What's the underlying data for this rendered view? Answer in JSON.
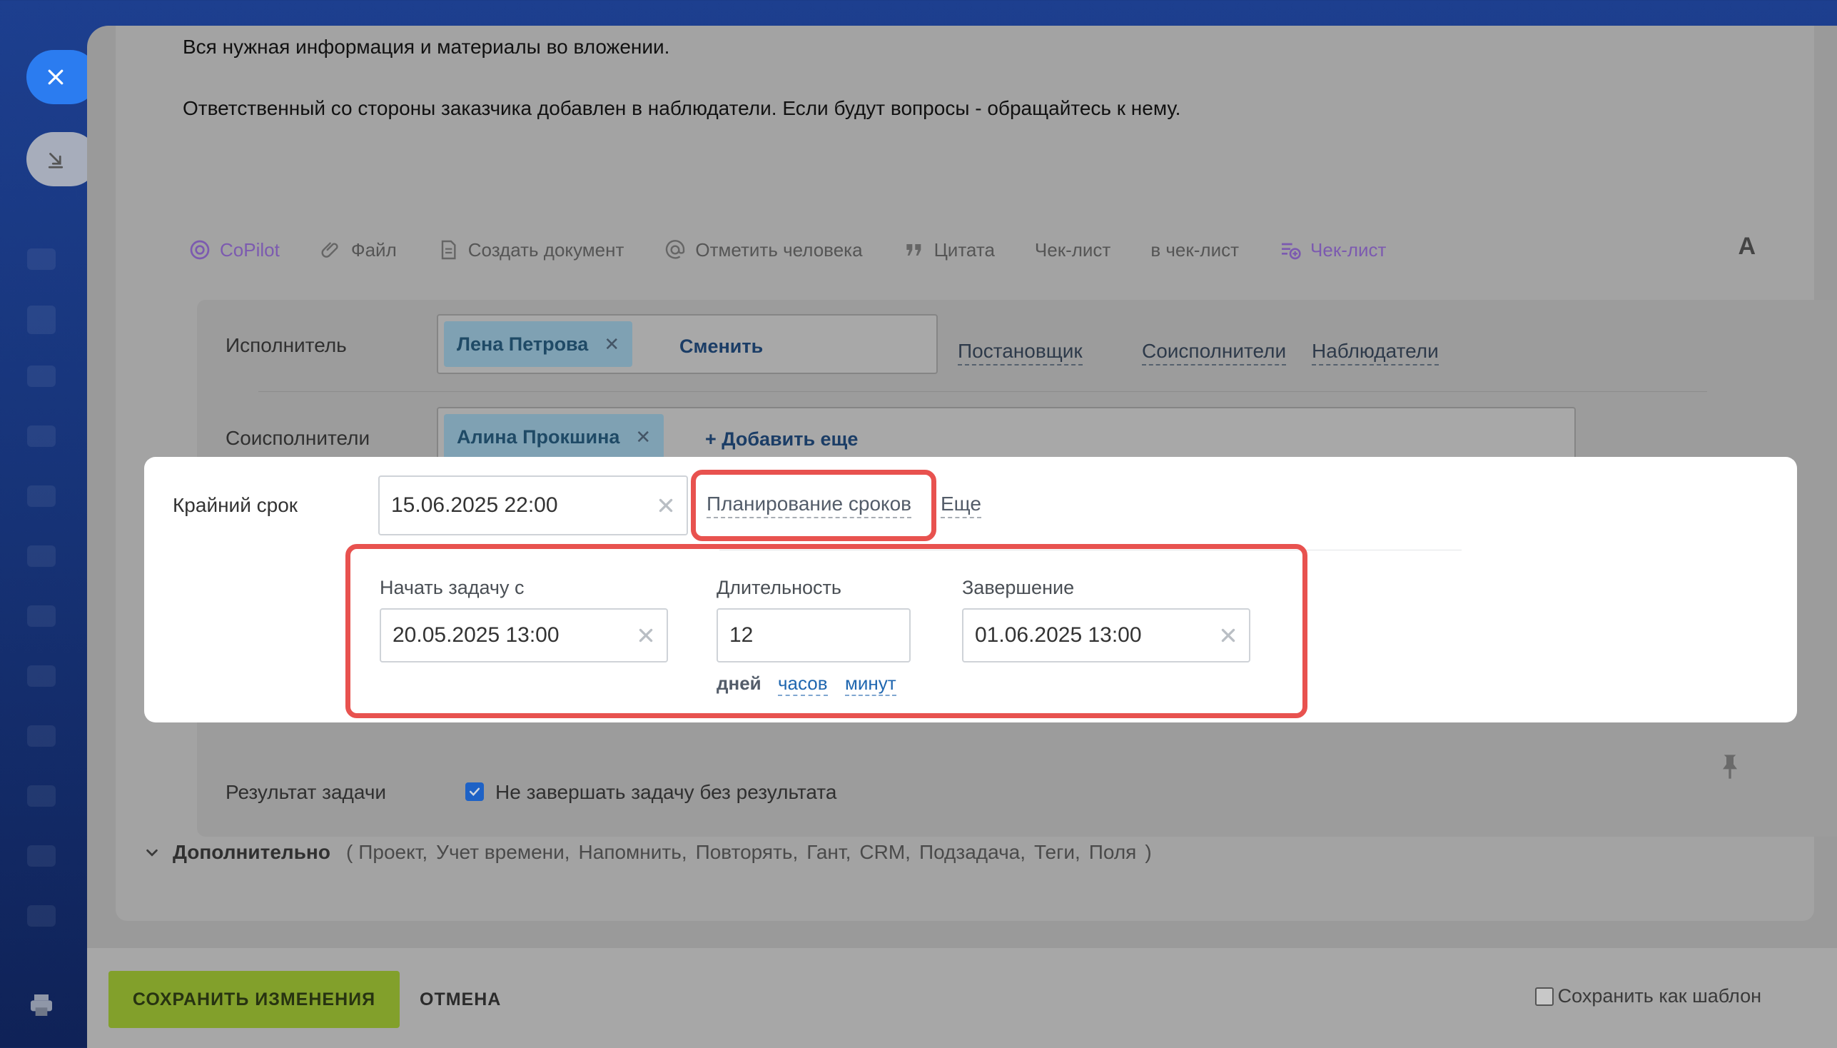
{
  "description": {
    "line1": "Вся нужная информация и материалы во вложении.",
    "line2": "Ответственный со стороны заказчика добавлен в наблюдатели. Если будут вопросы - обращайтесь к нему."
  },
  "toolbar": {
    "copilot": "CoPilot",
    "file": "Файл",
    "create_doc": "Создать документ",
    "mention": "Отметить человека",
    "quote": "Цитата",
    "checklist_text": "Чек-лист",
    "to_checklist": "в чек-лист",
    "checklist_add": "Чек-лист",
    "font_toggle": "A"
  },
  "assignee": {
    "label": "Исполнитель",
    "person": "Лена Петрова",
    "change": "Сменить",
    "links": [
      "Постановщик",
      "Соисполнители",
      "Наблюдатели"
    ]
  },
  "coexecutors": {
    "label": "Соисполнители",
    "person": "Алина Прокшина",
    "add_more": "+ Добавить еще"
  },
  "deadline": {
    "label": "Крайний срок",
    "value": "15.06.2025 22:00",
    "planning_link": "Планирование сроков",
    "more_link": "Еще",
    "start_label": "Начать задачу с",
    "start_value": "20.05.2025 13:00",
    "duration_label": "Длительность",
    "duration_value": "12",
    "end_label": "Завершение",
    "end_value": "01.06.2025 13:00",
    "units": {
      "days": "дней",
      "hours": "часов",
      "minutes": "минут"
    }
  },
  "result": {
    "label": "Результат задачи",
    "checkbox_label": "Не завершать задачу без результата",
    "checked": true
  },
  "additional": {
    "title": "Дополнительно",
    "open_paren": "(",
    "close_paren": ")",
    "items": [
      "Проект,",
      "Учет времени,",
      "Напомнить,",
      "Повторять,",
      "Гант,",
      "CRM,",
      "Подзадача,",
      "Теги,",
      "Поля"
    ]
  },
  "footer": {
    "save": "СОХРАНИТЬ ИЗМЕНЕНИЯ",
    "cancel": "ОТМЕНА",
    "save_template": "Сохранить как шаблон"
  },
  "colors": {
    "highlight_red": "#e8524f",
    "save_green": "#82a02b",
    "link_blue": "#2067b0",
    "checkbox_blue": "#1e62c6"
  }
}
